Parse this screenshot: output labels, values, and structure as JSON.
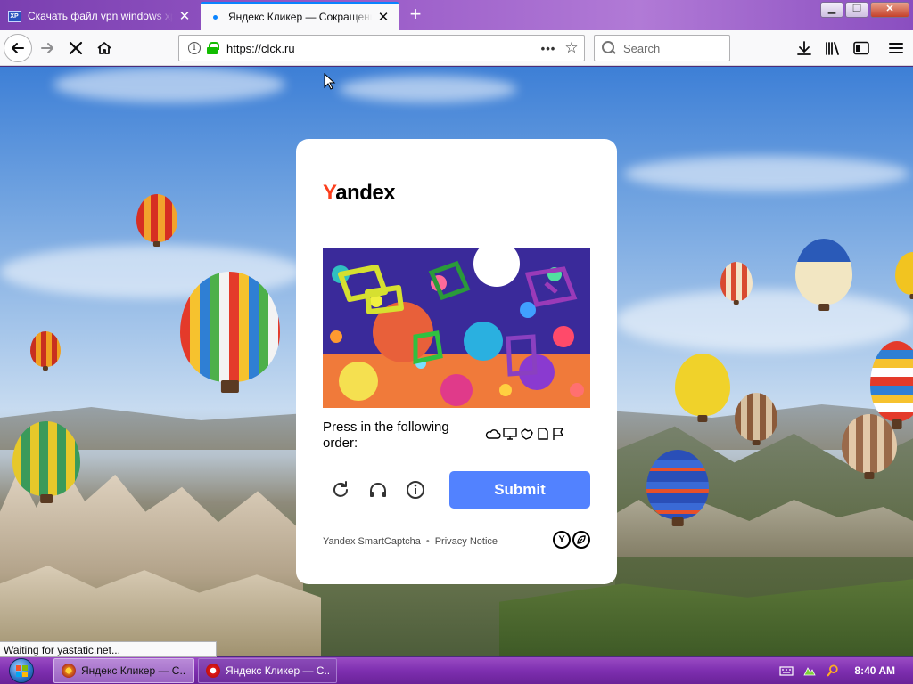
{
  "browser": {
    "tabs": [
      {
        "title": "Скачать файл vpn windows xp",
        "active": false
      },
      {
        "title": "Яндекс Кликер — Сокращение",
        "active": true
      }
    ],
    "url": "https://clck.ru",
    "search_placeholder": "Search",
    "status_text": "Waiting for yastatic.net..."
  },
  "captcha": {
    "logo_first": "Y",
    "logo_rest": "andex",
    "prompt": "Press in the following order:",
    "order_icons": [
      "cloud-icon",
      "monitor-icon",
      "fist-icon",
      "document-icon",
      "flag-icon"
    ],
    "submit_label": "Submit",
    "footer_brand": "Yandex SmartCaptcha",
    "footer_separator": "•",
    "footer_privacy": "Privacy Notice",
    "badge_y": "Y"
  },
  "taskbar": {
    "items": [
      {
        "label": "Яндекс Кликер — С...",
        "app": "firefox-icon"
      },
      {
        "label": "Яндекс Кликер — С...",
        "app": "opera-icon"
      }
    ],
    "clock": "8:40 AM"
  },
  "colors": {
    "submit": "#5282ff",
    "yandex_red": "#fc3f1d",
    "lock_green": "#12bc00",
    "taskbar_purple": "#7e2fb0"
  }
}
